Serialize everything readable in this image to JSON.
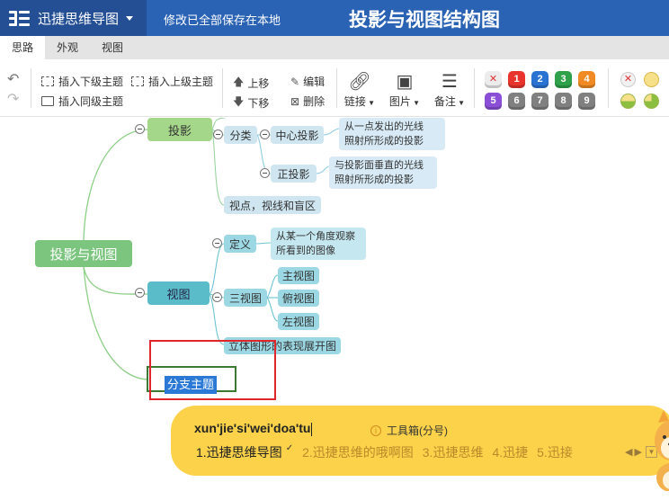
{
  "app": {
    "name": "迅捷思维导图",
    "save_status": "修改已全部保存在本地",
    "doc_title": "投影与视图结构图",
    "title_bar_color": "#2a62b4"
  },
  "tabs": [
    {
      "label": "思路",
      "active": true
    },
    {
      "label": "外观",
      "active": false
    },
    {
      "label": "视图",
      "active": false
    }
  ],
  "toolbar": {
    "undo_icon": "undo-icon",
    "redo_icon": "redo-icon",
    "insert_child": "插入下级主题",
    "insert_parent": "插入上级主题",
    "insert_sibling": "插入同级主题",
    "move_up": "上移",
    "move_down": "下移",
    "edit": "编辑",
    "delete": "删除",
    "link": "链接",
    "image": "图片",
    "note": "备注",
    "priority_badges": [
      {
        "label": "✕",
        "color": "#e8e8e8",
        "text_color": "#d33"
      },
      {
        "label": "1",
        "color": "#e8342c"
      },
      {
        "label": "2",
        "color": "#2b73d2"
      },
      {
        "label": "3",
        "color": "#2ea14a"
      },
      {
        "label": "4",
        "color": "#f08a24"
      },
      {
        "label": "5",
        "color": "#8a4fd6"
      },
      {
        "label": "6",
        "color": "#808080"
      },
      {
        "label": "7",
        "color": "#808080"
      },
      {
        "label": "8",
        "color": "#808080"
      },
      {
        "label": "9",
        "color": "#808080"
      }
    ]
  },
  "mindmap": {
    "root": "投影与视图",
    "projection": {
      "label": "投影",
      "classify": "分类",
      "central": "中心投影",
      "central_desc_1": "从一点发出的光线",
      "central_desc_2": "照射所形成的投影",
      "parallel": "正投影",
      "parallel_desc_1": "与投影面垂直的光线",
      "parallel_desc_2": "照射所形成的投影",
      "viewpoint": "视点，视线和盲区"
    },
    "view": {
      "label": "视图",
      "definition": "定义",
      "definition_desc_1": "从某一个角度观察",
      "definition_desc_2": "所看到的图像",
      "three_views": "三视图",
      "front": "主视图",
      "top": "俯视图",
      "left": "左视图",
      "unfold": "立体图形的表现展开图"
    },
    "new_branch_text": "分支主题"
  },
  "ime": {
    "pinyin": "xun'jie'si'wei'doa'tu",
    "toolbox": "工具箱(分号)",
    "candidates": [
      "1.迅捷思维导图",
      "2.迅捷思维的哦啊图",
      "3.迅捷思维",
      "4.迅捷",
      "5.迅接"
    ]
  }
}
